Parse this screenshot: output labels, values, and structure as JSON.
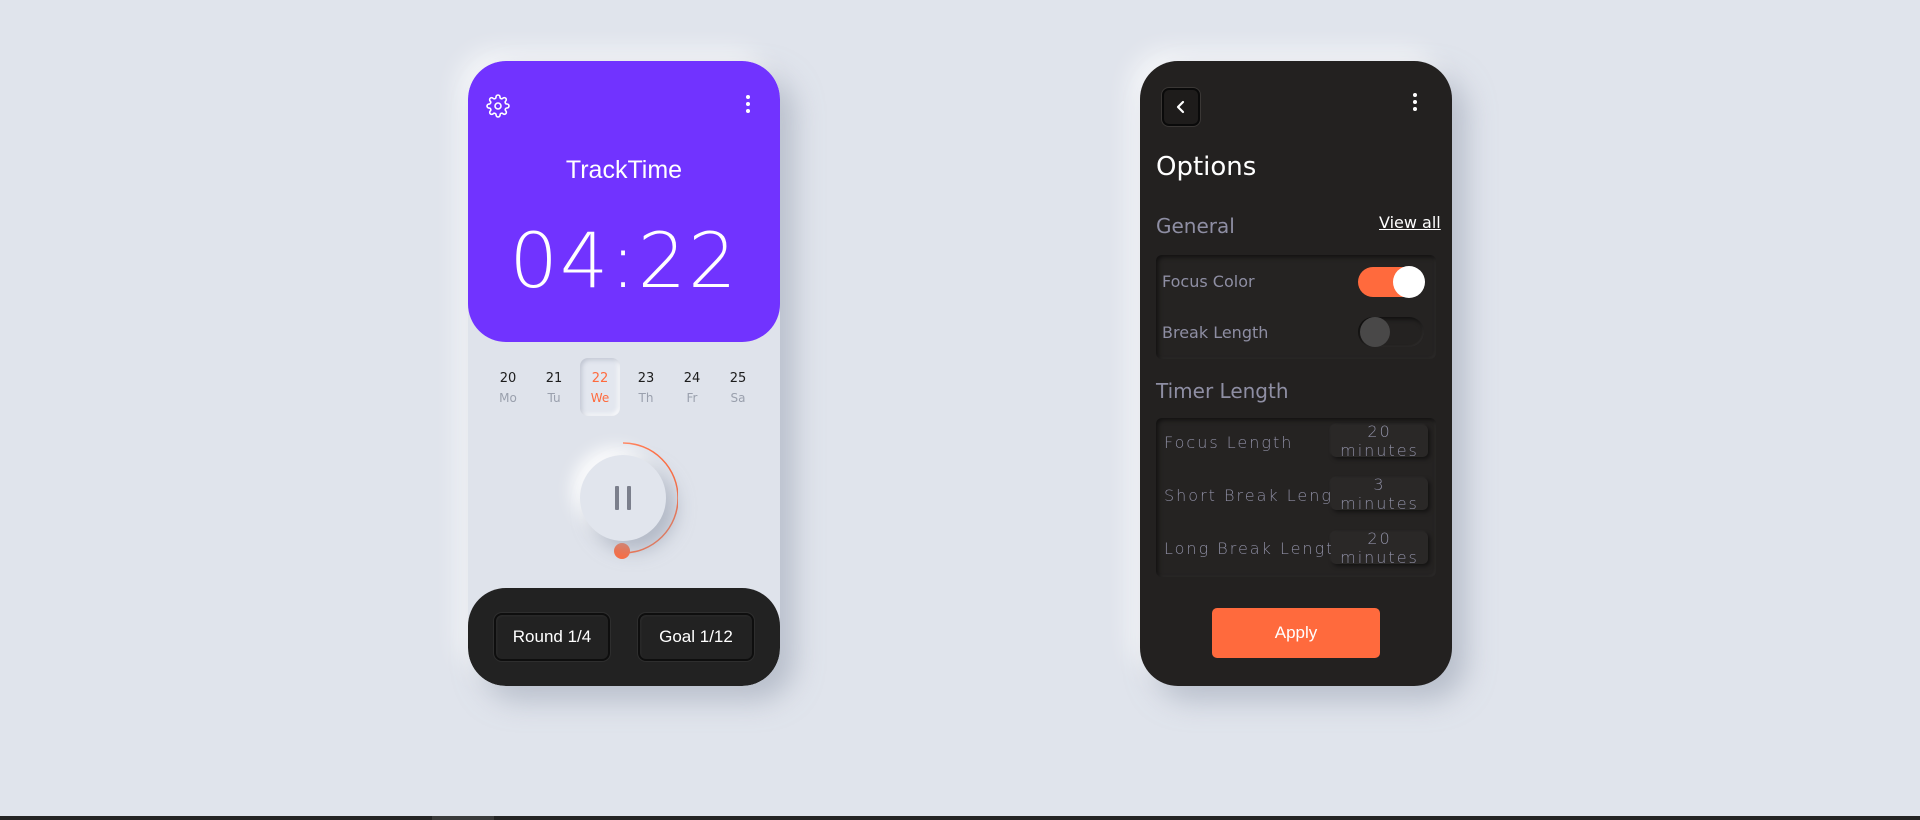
{
  "timer_screen": {
    "app_title": "TrackTime",
    "timer_value": "04:22",
    "icons": {
      "settings": "gear-icon",
      "menu": "more-vertical-icon",
      "control": "pause-icon"
    },
    "days": [
      {
        "num": "20",
        "weekday": "Mo",
        "active": false
      },
      {
        "num": "21",
        "weekday": "Tu",
        "active": false
      },
      {
        "num": "22",
        "weekday": "We",
        "active": true
      },
      {
        "num": "23",
        "weekday": "Th",
        "active": false
      },
      {
        "num": "24",
        "weekday": "Fr",
        "active": false
      },
      {
        "num": "25",
        "weekday": "Sa",
        "active": false
      }
    ],
    "round_label": "Round 1/4",
    "goal_label": "Goal 1/12",
    "progress_fraction": 0.5
  },
  "options_screen": {
    "title": "Options",
    "icons": {
      "back": "chevron-left-icon",
      "menu": "more-vertical-icon"
    },
    "general": {
      "label": "General",
      "view_all": "View all",
      "toggles": [
        {
          "label": "Focus Color",
          "on": true
        },
        {
          "label": "Break Length",
          "on": false
        }
      ]
    },
    "timer_length": {
      "label": "Timer Length",
      "rows": [
        {
          "label": "Focus Length",
          "value": "20 minutes"
        },
        {
          "label": "Short Break Length",
          "value": "3 minutes"
        },
        {
          "label": "Long Break Length",
          "value": "20 minutes"
        }
      ]
    },
    "apply_label": "Apply"
  },
  "colors": {
    "background": "#e0e4ec",
    "header_purple": "#7133ff",
    "accent_orange": "#ff6a3d",
    "dark_panel": "#232120",
    "muted_text": "#8e8ea3"
  }
}
